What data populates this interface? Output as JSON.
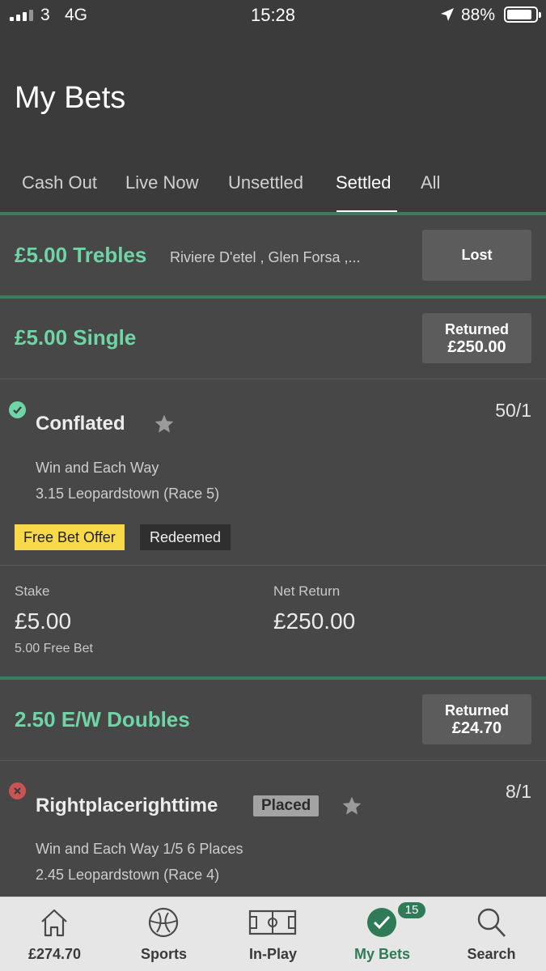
{
  "status_bar": {
    "carrier": "3",
    "network": "4G",
    "time": "15:28",
    "battery": "88%",
    "battery_level": 0.88
  },
  "header": {
    "title": "My Bets"
  },
  "tabs": [
    "Cash Out",
    "Live Now",
    "Unsettled",
    "Settled",
    "All"
  ],
  "active_tab": "Settled",
  "bets": [
    {
      "title": "£5.00 Trebles",
      "selections_summary": "Riviere D'etel , Glen Forsa ,...",
      "status": "Lost"
    },
    {
      "title": "£5.00 Single",
      "status_label": "Returned",
      "status_amount": "£250.00",
      "selection": {
        "result": "won",
        "name": "Conflated",
        "odds": "50/1",
        "market": "Win and Each Way",
        "event": "3.15 Leopardstown (Race 5)",
        "promo_label": "Free Bet Offer",
        "promo_state": "Redeemed"
      },
      "stake_label": "Stake",
      "stake": "£5.00",
      "stake_note": "5.00 Free Bet",
      "net_return_label": "Net Return",
      "net_return": "£250.00"
    },
    {
      "title": "2.50 E/W Doubles",
      "status_label": "Returned",
      "status_amount": "£24.70",
      "selection": {
        "result": "lost",
        "name": "Rightplacerighttime",
        "tag": "Placed",
        "odds": "8/1",
        "market": "Win and Each Way 1/5 6 Places",
        "event": "2.45 Leopardstown (Race 4)"
      }
    }
  ],
  "bottom_nav": [
    {
      "label": "£274.70",
      "icon": "home-icon"
    },
    {
      "label": "Sports",
      "icon": "football-icon"
    },
    {
      "label": "In-Play",
      "icon": "pitch-icon"
    },
    {
      "label": "My Bets",
      "icon": "check-circle-icon",
      "badge": "15"
    },
    {
      "label": "Search",
      "icon": "search-icon"
    }
  ],
  "colors": {
    "accent_green": "#6fd4a6",
    "nav_green": "#2f7a57",
    "free_bet_yellow": "#f8d94a",
    "lost_red": "#c95454"
  }
}
